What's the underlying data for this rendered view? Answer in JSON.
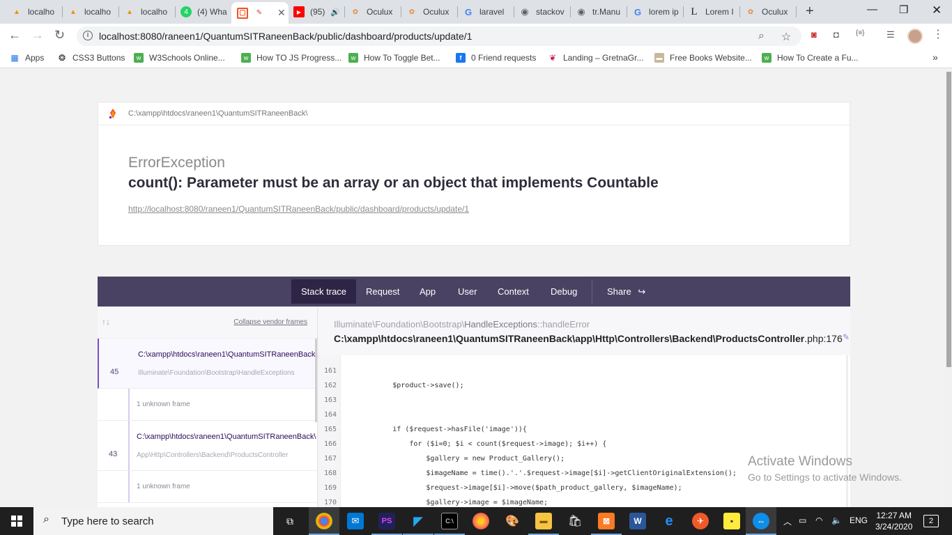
{
  "browser": {
    "tabs": [
      {
        "title": "localho",
        "icon": "phpmyadmin-icon",
        "color": "#f29111"
      },
      {
        "title": "localho",
        "icon": "phpmyadmin-icon",
        "color": "#f29111"
      },
      {
        "title": "localho",
        "icon": "phpmyadmin-icon",
        "color": "#f29111"
      },
      {
        "title": "(4) Wha",
        "icon": "whatsapp-icon",
        "color": "#25d366"
      },
      {
        "title": "",
        "icon": "ignition-icon",
        "color": "#f4511e",
        "active": true
      },
      {
        "title": "(95)",
        "icon": "youtube-icon",
        "color": "#ff0000"
      },
      {
        "title": "Oculux",
        "icon": "oculux-icon",
        "color": "#e88b3c"
      },
      {
        "title": "Oculux",
        "icon": "oculux-icon",
        "color": "#e88b3c"
      },
      {
        "title": "laravel",
        "icon": "google-icon",
        "color": "#4285f4"
      },
      {
        "title": "stackov",
        "icon": "globe-icon",
        "color": "#5f6368"
      },
      {
        "title": "tr.Manu",
        "icon": "globe-icon",
        "color": "#5f6368"
      },
      {
        "title": "lorem ip",
        "icon": "google-icon",
        "color": "#4285f4"
      },
      {
        "title": "Lorem I",
        "icon": "lorem-icon",
        "color": "#202124"
      },
      {
        "title": "Oculux",
        "icon": "oculux-icon",
        "color": "#e88b3c"
      }
    ],
    "url": "localhost:8080/raneen1/QuantumSITRaneenBack/public/dashboard/products/update/1",
    "bookmarks": [
      {
        "label": "Apps",
        "icon": "apps-grid-icon"
      },
      {
        "label": "CSS3 Buttons",
        "icon": "css3-icon"
      },
      {
        "label": "W3Schools Online...",
        "icon": "w3schools-icon"
      },
      {
        "label": "How TO JS Progress...",
        "icon": "w3schools-icon"
      },
      {
        "label": "How To Toggle Bet...",
        "icon": "w3schools-icon"
      },
      {
        "label": "0 Friend requests",
        "icon": "facebook-icon"
      },
      {
        "label": "Landing – GretnaGr...",
        "icon": "gretna-icon"
      },
      {
        "label": "Free Books Website...",
        "icon": "books-icon"
      },
      {
        "label": "How To Create a Fu...",
        "icon": "w3schools-icon"
      }
    ],
    "more_bookmarks": "»"
  },
  "error": {
    "root_path": "C:\\xampp\\htdocs\\raneen1\\QuantumSITRaneenBack\\",
    "exception": "ErrorException",
    "message": "count(): Parameter must be an array or an object that implements Countable",
    "url": "http://localhost:8080/raneen1/QuantumSITRaneenBack/public/dashboard/products/update/1"
  },
  "trace_tabs": {
    "items": [
      "Stack trace",
      "Request",
      "App",
      "User",
      "Context",
      "Debug"
    ],
    "share": "Share",
    "active": "Stack trace"
  },
  "frames": {
    "arrows": "↑↓",
    "collapse": "Collapse vendor frames",
    "list": [
      {
        "type": "app",
        "number": "45",
        "path": "C:\\xampp\\htdocs\\raneen1\\QuantumSITRaneenBack\\",
        "class": "Illuminate\\Foundation\\Bootstrap\\HandleExceptions",
        "selected": true
      },
      {
        "type": "unknown",
        "label": "1 unknown frame"
      },
      {
        "type": "app",
        "number": "43",
        "path": "C:\\xampp\\htdocs\\raneen1\\QuantumSITRaneenBack\\",
        "class": "App\\Http\\Controllers\\Backend\\ProductsController"
      },
      {
        "type": "unknown",
        "label": "1 unknown frame"
      }
    ]
  },
  "code": {
    "class_prefix": "Illuminate\\Foundation\\Bootstrap\\",
    "class_name": "HandleExceptions",
    "method": "::handleError",
    "file": "C:\\xampp\\htdocs\\raneen1\\QuantumSITRaneenBack\\app\\Http\\Controllers\\Backend\\ProductsController",
    "file_ext": ".php:176",
    "lines": [
      {
        "n": "161",
        "code": ""
      },
      {
        "n": "162",
        "code": "            $product->save();"
      },
      {
        "n": "163",
        "code": ""
      },
      {
        "n": "164",
        "code": ""
      },
      {
        "n": "165",
        "code": "            if ($request->hasFile('image')){"
      },
      {
        "n": "166",
        "code": "                for ($i=0; $i < count($request->image); $i++) {"
      },
      {
        "n": "167",
        "code": "                    $gallery = new Product_Gallery();"
      },
      {
        "n": "168",
        "code": "                    $imageName = time().'.'.$request->image[$i]->getClientOriginalExtension();"
      },
      {
        "n": "169",
        "code": "                    $request->image[$i]->move($path_product_gallery, $imageName);"
      },
      {
        "n": "170",
        "code": "                    $gallery->image = $imageName;"
      }
    ]
  },
  "watermark": {
    "title": "Activate Windows",
    "subtitle": "Go to Settings to activate Windows."
  },
  "taskbar": {
    "search_placeholder": "Type here to search",
    "lang": "ENG",
    "time": "12:27 AM",
    "date": "3/24/2020",
    "notifications": "2"
  }
}
